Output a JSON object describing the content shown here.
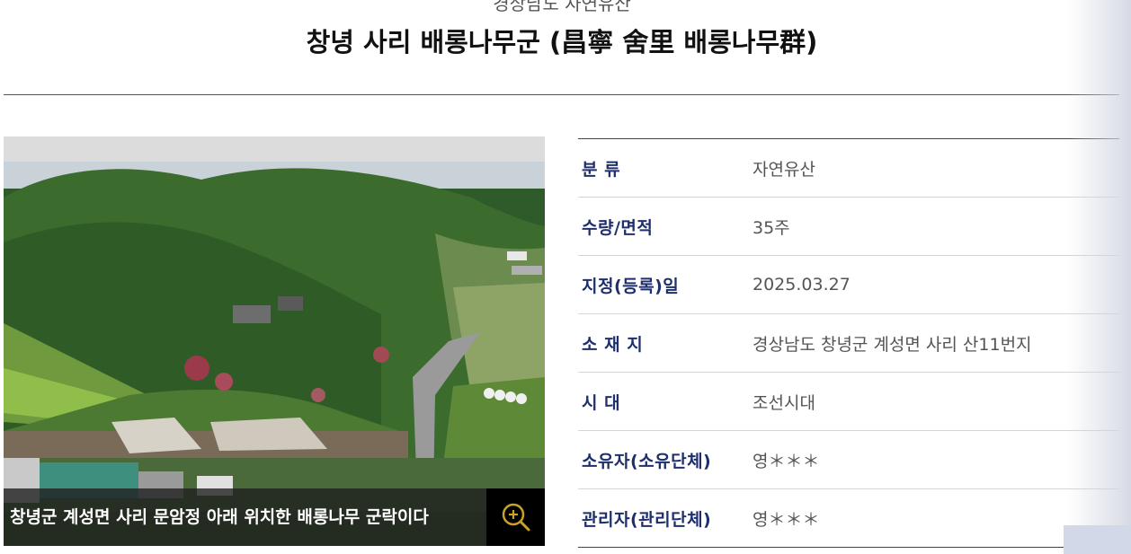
{
  "header": {
    "category_title": "경상남도 자연유산",
    "heritage_name": "창녕 사리 배롱나무군 (昌寧 舍里 배롱나무群)"
  },
  "photo": {
    "caption": "창녕군 계성면 사리 문암정 아래 위치한 배롱나무 군락이다",
    "zoom_icon": "zoom-in-icon",
    "accent_color": "#c9a227"
  },
  "info": {
    "rows": [
      {
        "label": "분 류",
        "value": "자연유산"
      },
      {
        "label": "수량/면적",
        "value": "35주"
      },
      {
        "label": "지정(등록)일",
        "value": "2025.03.27"
      },
      {
        "label": "소 재 지",
        "value": "경상남도 창녕군 계성면 사리 산11번지"
      },
      {
        "label": "시 대",
        "value": "조선시대"
      },
      {
        "label": "소유자(소유단체)",
        "value": "영＊＊＊"
      },
      {
        "label": "관리자(관리단체)",
        "value": "영＊＊＊"
      }
    ]
  },
  "colors": {
    "label": "#1f2f6b",
    "value": "#555555"
  }
}
